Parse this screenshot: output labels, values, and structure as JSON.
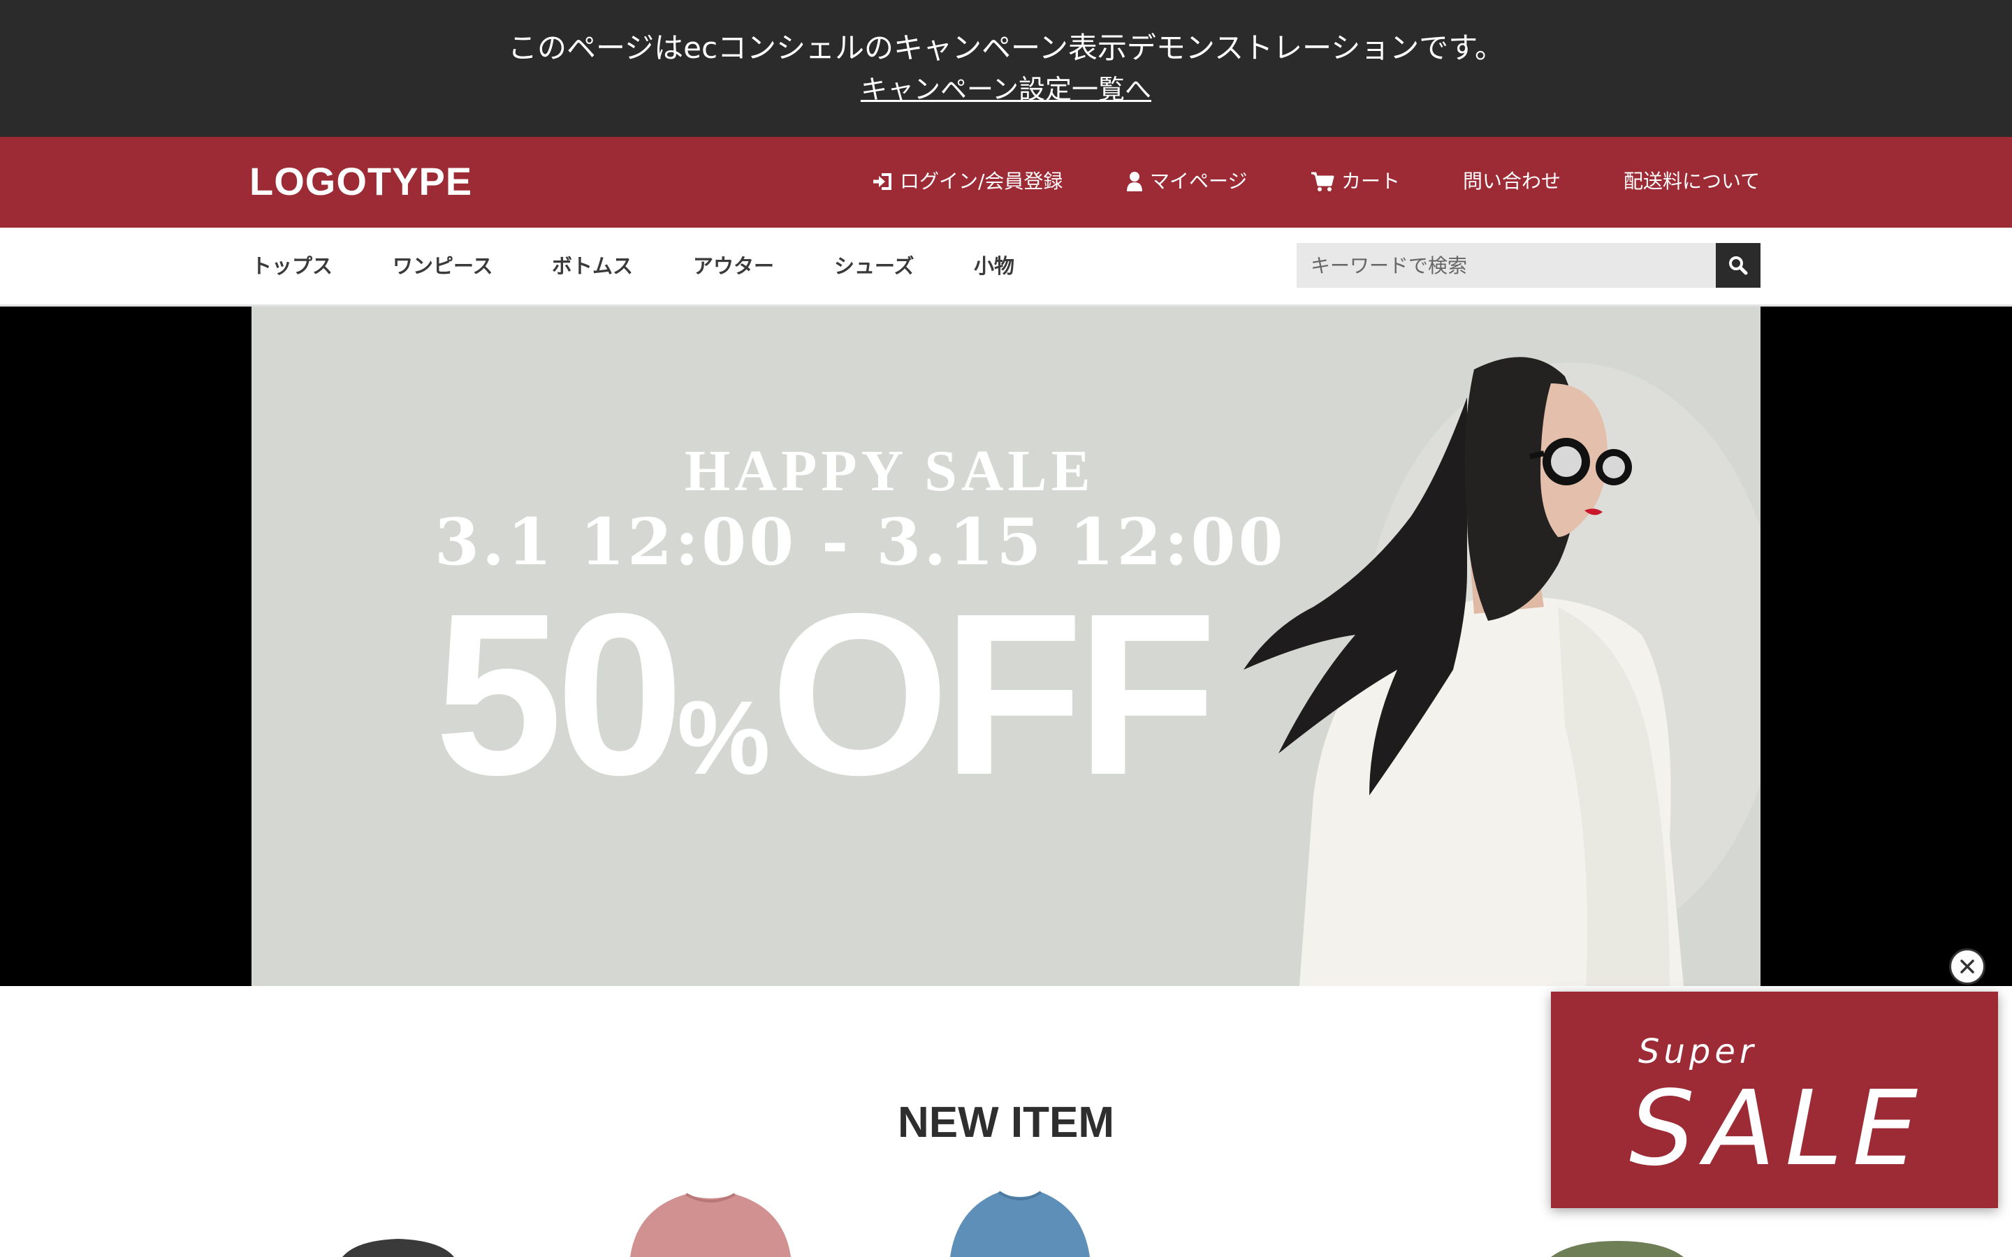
{
  "demo_bar": {
    "message": "このページはecコンシェルのキャンペーン表示デモンストレーションです。",
    "link_label": "キャンペーン設定一覧へ"
  },
  "header": {
    "logo": "LOGOTYPE",
    "nav": [
      {
        "label": "ログイン/会員登録",
        "icon": "login-icon"
      },
      {
        "label": "マイページ",
        "icon": "user-icon"
      },
      {
        "label": "カート",
        "icon": "cart-icon"
      },
      {
        "label": "問い合わせ"
      },
      {
        "label": "配送料について"
      }
    ]
  },
  "categories": [
    "トップス",
    "ワンピース",
    "ボトムス",
    "アウター",
    "シューズ",
    "小物"
  ],
  "search": {
    "placeholder": "キーワードで検索",
    "icon": "search-icon"
  },
  "hero": {
    "headline": "HAPPY SALE",
    "dates": "3.1 12:00 - 3.15 12:00",
    "discount_number": "50",
    "discount_unit": "%",
    "discount_word": "OFF"
  },
  "new_item": {
    "title": "NEW ITEM"
  },
  "popup": {
    "line1": "Super",
    "line2": "SALE",
    "close_icon": "close-icon"
  },
  "colors": {
    "brand": "#9c2b36",
    "dark": "#2b2b2b",
    "hero_bg": "#d5d7d2"
  }
}
